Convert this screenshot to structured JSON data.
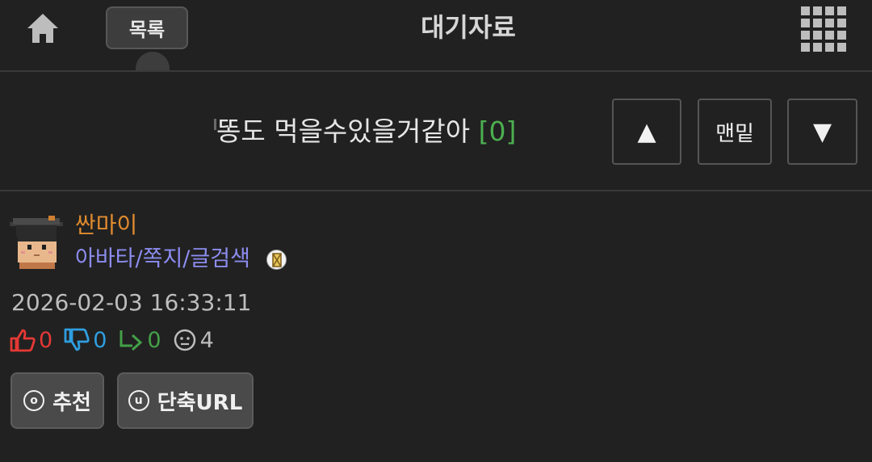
{
  "header": {
    "home_icon": "home-icon",
    "list_label": "목록",
    "title": "대기자료",
    "menu_icon": "grid-menu-icon"
  },
  "post": {
    "title": "똥도 먹을수있을거같아",
    "comment_count": "[0]",
    "nav": {
      "up_label": "▲",
      "bottom_label": "맨밑",
      "down_label": "▼"
    }
  },
  "author": {
    "nickname": "싼마이",
    "links": "아바타/쪽지/글검색",
    "timestamp": "2026-02-03 16:33:11"
  },
  "stats": {
    "upvotes": "0",
    "downvotes": "0",
    "replies": "0",
    "views": "4"
  },
  "actions": {
    "recommend_label": "추천",
    "recommend_icon_letter": "o",
    "shorturl_label": "단축URL",
    "shorturl_icon_letter": "u"
  },
  "colors": {
    "background": "#212121",
    "nickname": "#e08b2f",
    "links": "#8c8cf0",
    "comment_count": "#4caf50",
    "upvote": "#e53935",
    "downvote": "#2f9ee0",
    "reply": "#43a047"
  }
}
